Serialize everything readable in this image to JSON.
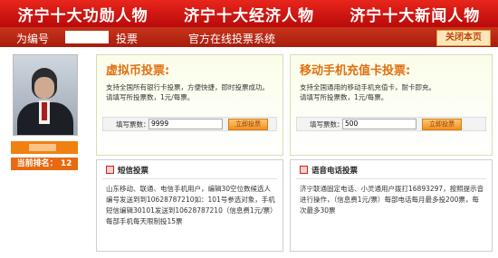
{
  "banner": {
    "item1": "济宁十大功勋人物",
    "item2": "济宁十大经济人物",
    "item3": "济宁十大新闻人物"
  },
  "titlebar": {
    "prefix": "为编号",
    "vote": "投票",
    "system": "官方在线投票系统",
    "close": "关闭本页"
  },
  "candidate": {
    "rank_label": "当前排名：",
    "rank_value": "12"
  },
  "virtual_vote": {
    "title": "虚拟币投票:",
    "line1": "支持全国所有银行卡投票，方便快捷，即时投票成功。",
    "line2": "请填写所投票数，1元/每票。",
    "input_label": "填写票数：",
    "input_value": "9999",
    "button": "立即投票"
  },
  "mobile_vote": {
    "title": "移动手机充值卡投票:",
    "line1": "支持全国通用的移动手机充值卡，耐卡即充。",
    "line2": "请填写所投票数，1元/每票。",
    "input_label": "填写票数：",
    "input_value": "500",
    "button": "立即投票"
  },
  "sms_vote": {
    "title": "短信投票",
    "body": "山东移动、联通、电信手机用户，编辑30空位数候选人编号发送到到10628787210如：101号参选对象，手机短信编辑30101发送到10628787210（信息费1元/票）每部手机每天限制投15票"
  },
  "voice_vote": {
    "title": "语音电话投票",
    "body": "济宁联通固定电话、小灵通用户拨打16893297，按照提示音进行操作，（信息费1元/票）每部电话每月最多投200票，每次最多30票"
  }
}
